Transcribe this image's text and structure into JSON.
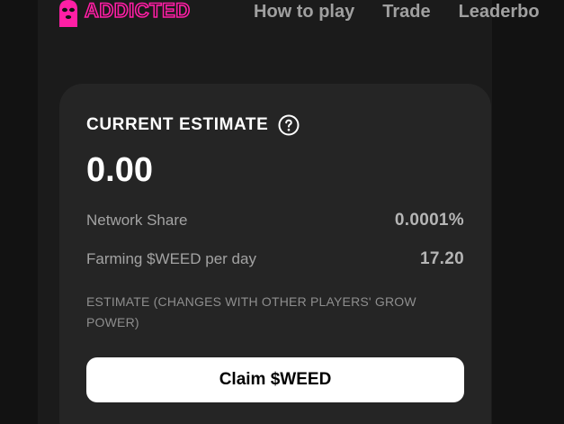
{
  "brand": {
    "name": "ADDICTED",
    "logo_icon": "ski-mask-icon",
    "accent_color": "#ff1fa5"
  },
  "nav": {
    "items": [
      {
        "label": "How to play"
      },
      {
        "label": "Trade"
      },
      {
        "label": "Leaderbo"
      }
    ]
  },
  "card": {
    "title": "CURRENT ESTIMATE",
    "help_icon": "question-circle-icon",
    "estimate_value": "0.00",
    "stats": [
      {
        "label": "Network Share",
        "value": "0.0001%"
      },
      {
        "label": "Farming $WEED per day",
        "value": "17.20"
      }
    ],
    "note": "ESTIMATE (CHANGES WITH OTHER PLAYERS' GROW POWER)",
    "claim_label": "Claim $WEED"
  }
}
